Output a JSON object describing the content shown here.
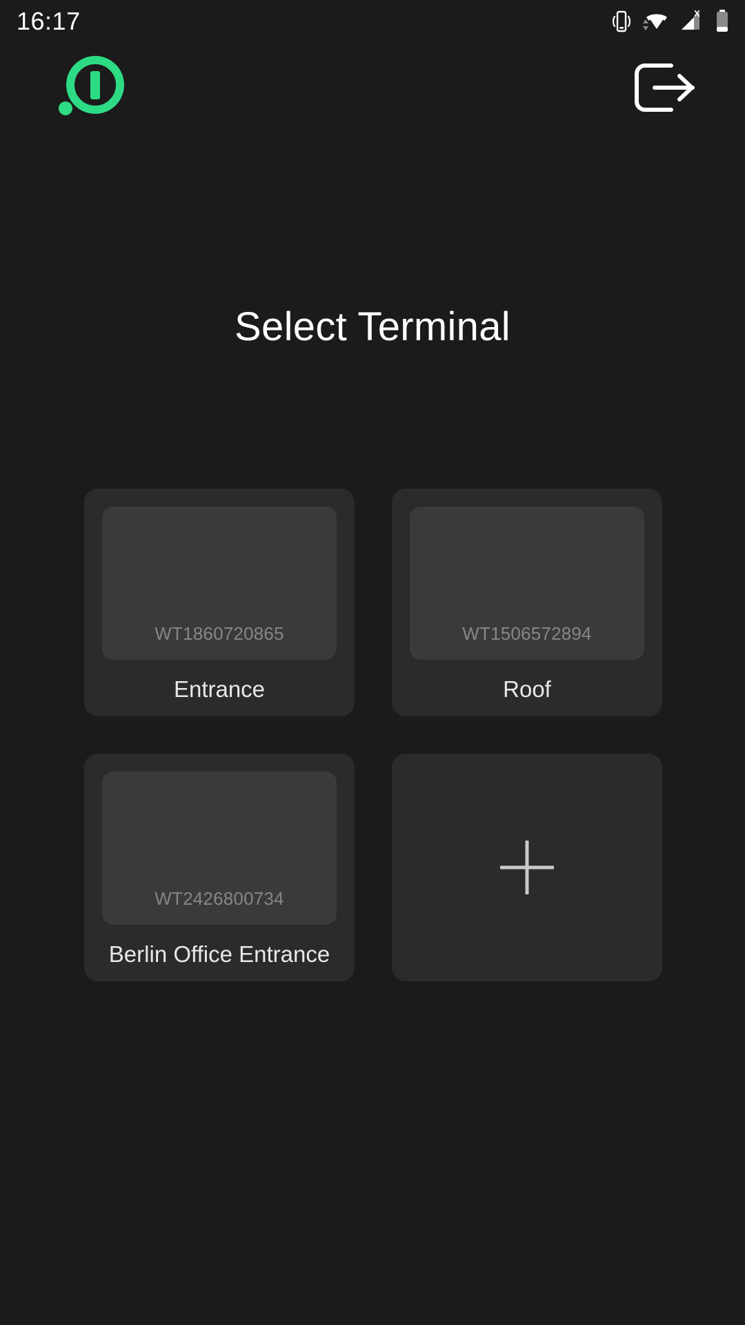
{
  "status_bar": {
    "time": "16:17",
    "icons": [
      {
        "name": "vibrate-icon"
      },
      {
        "name": "wifi-icon"
      },
      {
        "name": "cellular-signal-no-service-icon",
        "badge": "X"
      },
      {
        "name": "battery-icon"
      }
    ]
  },
  "app_bar": {
    "logo": {
      "name": "app-logo",
      "color": "#2edb85"
    },
    "logout": {
      "name": "logout-icon",
      "color": "#ffffff"
    }
  },
  "main": {
    "title": "Select Terminal",
    "terminals": [
      {
        "id": "WT1860720865",
        "label": "Entrance"
      },
      {
        "id": "WT1506572894",
        "label": "Roof"
      },
      {
        "id": "WT2426800734",
        "label": "Berlin Office Entrance"
      }
    ],
    "add_terminal": {
      "icon": "plus-icon"
    }
  },
  "colors": {
    "background": "#1b1b1b",
    "card": "#2b2b2b",
    "thumb": "#3a3a3a",
    "accent": "#2edb85",
    "text_primary": "#ffffff",
    "text_muted": "#868686"
  }
}
